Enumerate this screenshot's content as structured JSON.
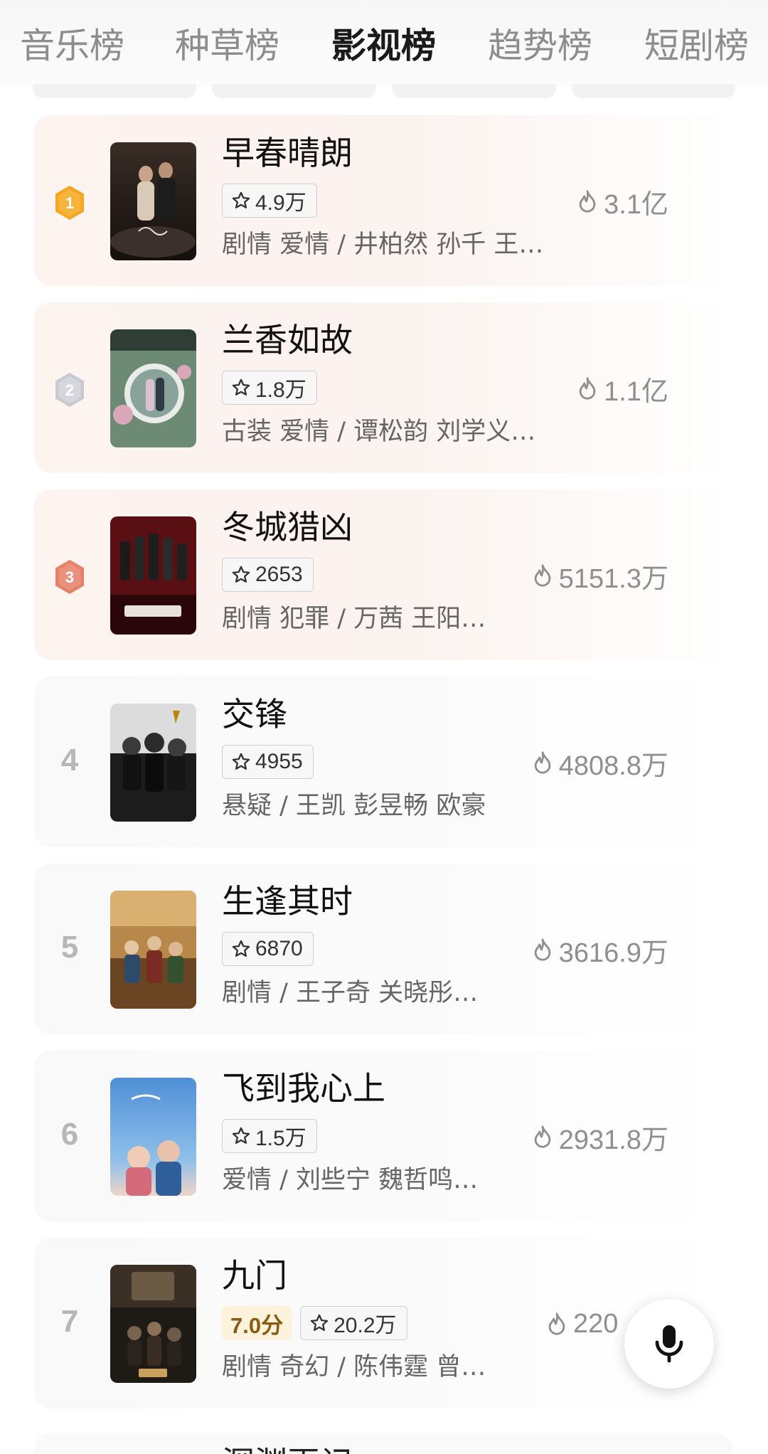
{
  "tabs": [
    {
      "label": "音乐榜"
    },
    {
      "label": "种草榜"
    },
    {
      "label": "影视榜",
      "active": true
    },
    {
      "label": "趋势榜"
    },
    {
      "label": "短剧榜"
    }
  ],
  "list": [
    {
      "rank": "1",
      "title": "早春晴朗",
      "rating_count": "4.9万",
      "meta": "剧情 爱情 / 井柏然 孙千 王…",
      "heat": "3.1亿"
    },
    {
      "rank": "2",
      "title": "兰香如故",
      "rating_count": "1.8万",
      "meta": "古装 爱情 / 谭松韵 刘学义…",
      "heat": "1.1亿"
    },
    {
      "rank": "3",
      "title": "冬城猎凶",
      "rating_count": "2653",
      "meta": "剧情 犯罪 / 万茜 王阳…",
      "heat": "5151.3万"
    },
    {
      "rank": "4",
      "title": "交锋",
      "rating_count": "4955",
      "meta": "悬疑 / 王凯 彭昱畅 欧豪",
      "heat": "4808.8万"
    },
    {
      "rank": "5",
      "title": "生逢其时",
      "rating_count": "6870",
      "meta": "剧情 / 王子奇 关晓彤…",
      "heat": "3616.9万"
    },
    {
      "rank": "6",
      "title": "飞到我心上",
      "rating_count": "1.5万",
      "meta": "爱情 / 刘些宁 魏哲鸣…",
      "heat": "2931.8万"
    },
    {
      "rank": "7",
      "title": "九门",
      "score": "7.0分",
      "rating_count": "20.2万",
      "meta": "剧情 奇幻 / 陈伟霆 曾…",
      "heat": "220"
    }
  ],
  "next_row": {
    "title": "深渊再记"
  },
  "colors": {
    "badge_gold": "#f5a623",
    "badge_silver": "#c9c9d2",
    "badge_bronze": "#e5806a",
    "top_row_bg": "#fdf3ef",
    "score_bg": "#fdf2dc"
  },
  "icons": {
    "rating": "star-outline-icon",
    "heat": "flame-outline-icon",
    "voice": "microphone-icon"
  }
}
